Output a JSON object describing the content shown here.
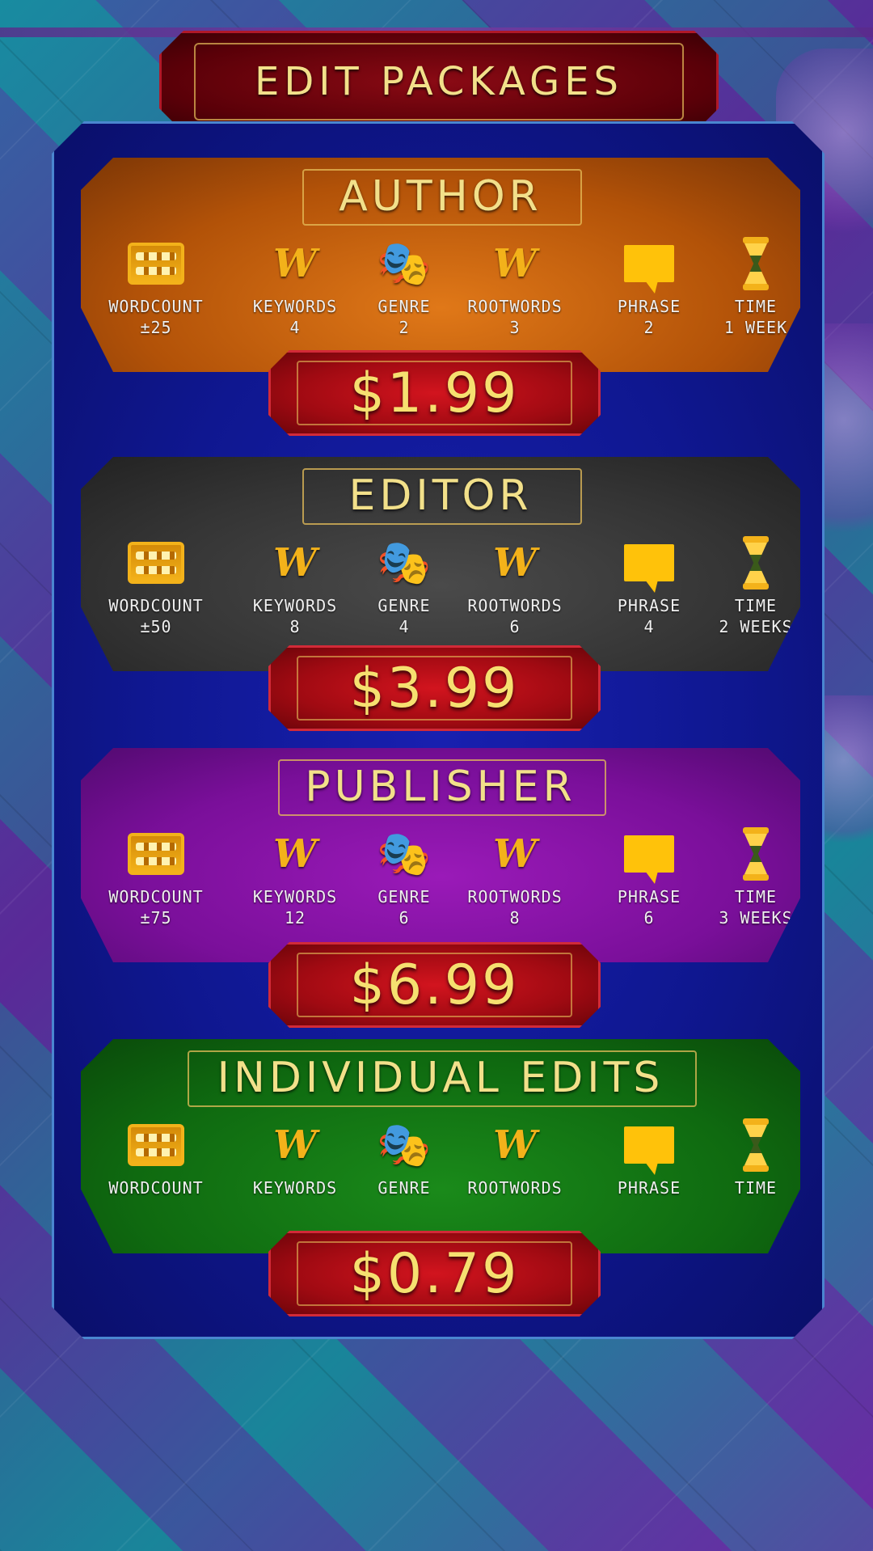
{
  "header": {
    "title": "EDIT PACKAGES"
  },
  "colors": {
    "gold_text": "#f2e08a",
    "author": "#b25208",
    "editor": "#343434",
    "publisher": "#7a0f9a",
    "individual": "#0f6a10",
    "price_red": "#a00a12",
    "panel_blue": "#0f1790"
  },
  "icons": [
    "abacus-icon",
    "keywords-w-key-icon",
    "theater-masks-icon",
    "rootwords-w-roots-icon",
    "speech-bubble-icon",
    "hourglass-icon"
  ],
  "packages": [
    {
      "name": "AUTHOR",
      "price": "$1.99",
      "features": [
        {
          "label": "WORDCOUNT",
          "value": "±25"
        },
        {
          "label": "KEYWORDS",
          "value": "4"
        },
        {
          "label": "GENRE",
          "value": "2"
        },
        {
          "label": "ROOTWORDS",
          "value": "3"
        },
        {
          "label": "PHRASE",
          "value": "2"
        },
        {
          "label": "TIME",
          "value": "1 WEEK"
        }
      ]
    },
    {
      "name": "EDITOR",
      "price": "$3.99",
      "features": [
        {
          "label": "WORDCOUNT",
          "value": "±50"
        },
        {
          "label": "KEYWORDS",
          "value": "8"
        },
        {
          "label": "GENRE",
          "value": "4"
        },
        {
          "label": "ROOTWORDS",
          "value": "6"
        },
        {
          "label": "PHRASE",
          "value": "4"
        },
        {
          "label": "TIME",
          "value": "2 WEEKS"
        }
      ]
    },
    {
      "name": "PUBLISHER",
      "price": "$6.99",
      "features": [
        {
          "label": "WORDCOUNT",
          "value": "±75"
        },
        {
          "label": "KEYWORDS",
          "value": "12"
        },
        {
          "label": "GENRE",
          "value": "6"
        },
        {
          "label": "ROOTWORDS",
          "value": "8"
        },
        {
          "label": "PHRASE",
          "value": "6"
        },
        {
          "label": "TIME",
          "value": "3 WEEKS"
        }
      ]
    },
    {
      "name": "INDIVIDUAL EDITS",
      "price": "$0.79",
      "features": [
        {
          "label": "WORDCOUNT",
          "value": ""
        },
        {
          "label": "KEYWORDS",
          "value": ""
        },
        {
          "label": "GENRE",
          "value": ""
        },
        {
          "label": "ROOTWORDS",
          "value": ""
        },
        {
          "label": "PHRASE",
          "value": ""
        },
        {
          "label": "TIME",
          "value": ""
        }
      ]
    }
  ]
}
